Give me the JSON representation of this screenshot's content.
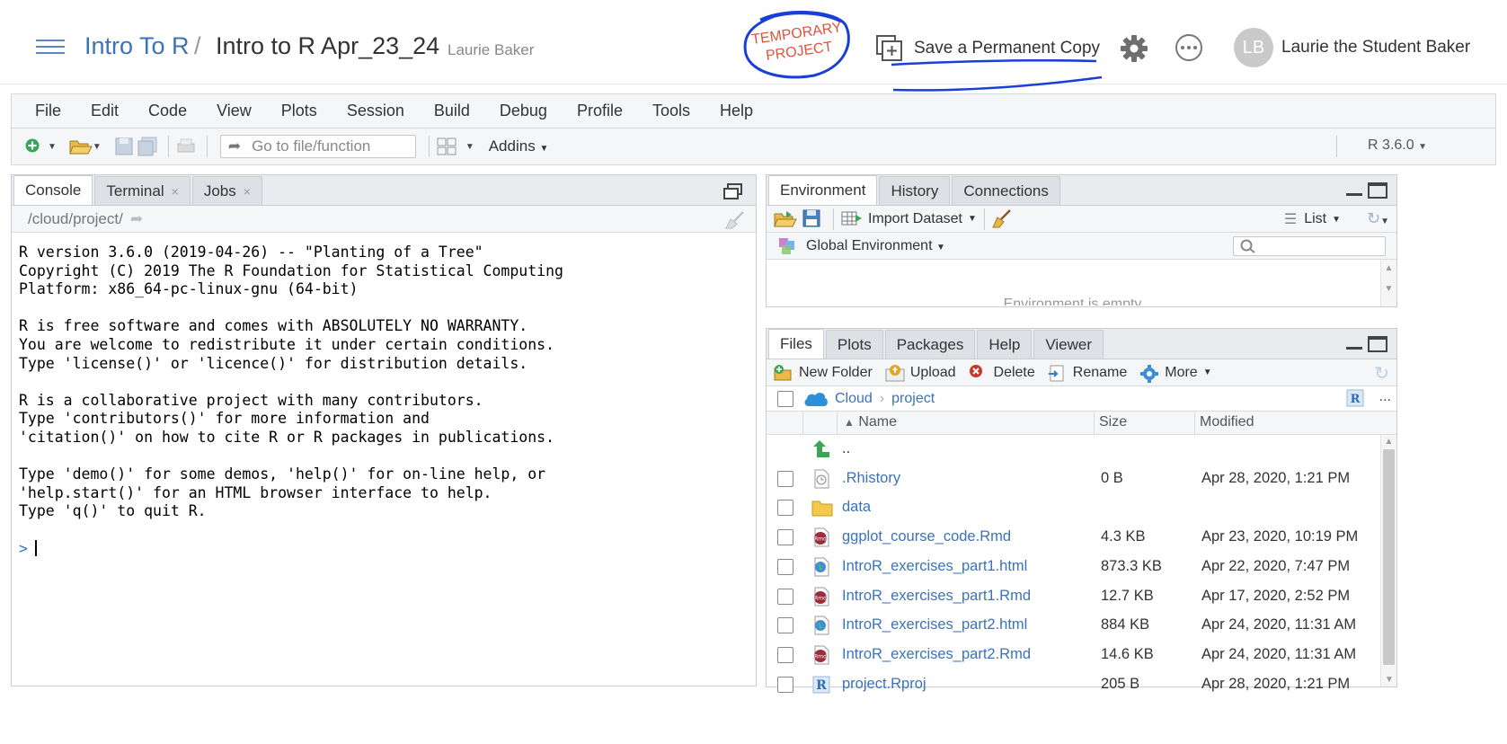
{
  "header": {
    "space": "Intro To R",
    "separator": "/",
    "project": "Intro to R Apr_23_24",
    "owner": "Laurie Baker",
    "temp_badge_line1": "TEMPORARY",
    "temp_badge_line2": "PROJECT",
    "save_copy": "Save a Permanent Copy",
    "avatar_initials": "LB",
    "user_name": "Laurie the Student Baker"
  },
  "menu": [
    "File",
    "Edit",
    "Code",
    "View",
    "Plots",
    "Session",
    "Build",
    "Debug",
    "Profile",
    "Tools",
    "Help"
  ],
  "toolbar": {
    "goto_placeholder": "Go to file/function",
    "addins": "Addins",
    "r_version": "R 3.6.0"
  },
  "console": {
    "tabs": [
      {
        "label": "Console",
        "closable": false
      },
      {
        "label": "Terminal",
        "closable": true
      },
      {
        "label": "Jobs",
        "closable": true
      }
    ],
    "close_glyph": "×",
    "path": "/cloud/project/",
    "prompt": ">",
    "lines": [
      "R version 3.6.0 (2019-04-26) -- \"Planting of a Tree\"",
      "Copyright (C) 2019 The R Foundation for Statistical Computing",
      "Platform: x86_64-pc-linux-gnu (64-bit)",
      "",
      "R is free software and comes with ABSOLUTELY NO WARRANTY.",
      "You are welcome to redistribute it under certain conditions.",
      "Type 'license()' or 'licence()' for distribution details.",
      "",
      "R is a collaborative project with many contributors.",
      "Type 'contributors()' for more information and",
      "'citation()' on how to cite R or R packages in publications.",
      "",
      "Type 'demo()' for some demos, 'help()' for on-line help, or",
      "'help.start()' for an HTML browser interface to help.",
      "Type 'q()' to quit R.",
      ""
    ]
  },
  "environment": {
    "tabs": [
      "Environment",
      "History",
      "Connections"
    ],
    "import_dataset": "Import Dataset",
    "list_view": "List",
    "scope": "Global Environment",
    "empty_message": "Environment is empty"
  },
  "files": {
    "tabs": [
      "Files",
      "Plots",
      "Packages",
      "Help",
      "Viewer"
    ],
    "tools": {
      "new_folder": "New Folder",
      "upload": "Upload",
      "delete": "Delete",
      "rename": "Rename",
      "more": "More"
    },
    "crumbs": [
      "Cloud",
      "project"
    ],
    "more_glyph": "...",
    "columns": {
      "name": "Name",
      "size": "Size",
      "modified": "Modified"
    },
    "parent": "..",
    "rows": [
      {
        "name": ".Rhistory",
        "size": "0 B",
        "modified": "Apr 28, 2020, 1:21 PM",
        "icon": "history-file-icon"
      },
      {
        "name": "data",
        "size": "",
        "modified": "",
        "icon": "folder-icon"
      },
      {
        "name": "ggplot_course_code.Rmd",
        "size": "4.3 KB",
        "modified": "Apr 23, 2020, 10:19 PM",
        "icon": "rmd-file-icon"
      },
      {
        "name": "IntroR_exercises_part1.html",
        "size": "873.3 KB",
        "modified": "Apr 22, 2020, 7:47 PM",
        "icon": "html-file-icon"
      },
      {
        "name": "IntroR_exercises_part1.Rmd",
        "size": "12.7 KB",
        "modified": "Apr 17, 2020, 2:52 PM",
        "icon": "rmd-file-icon"
      },
      {
        "name": "IntroR_exercises_part2.html",
        "size": "884 KB",
        "modified": "Apr 24, 2020, 11:31 AM",
        "icon": "html-file-icon"
      },
      {
        "name": "IntroR_exercises_part2.Rmd",
        "size": "14.6 KB",
        "modified": "Apr 24, 2020, 11:31 AM",
        "icon": "rmd-file-icon"
      },
      {
        "name": "project.Rproj",
        "size": "205 B",
        "modified": "Apr 28, 2020, 1:21 PM",
        "icon": "rproj-file-icon"
      }
    ]
  },
  "colors": {
    "link": "#3b73b9",
    "annotation_red": "#e0533d",
    "annotation_blue": "#1a3fd6",
    "pane_bg": "#f4f6f8"
  }
}
